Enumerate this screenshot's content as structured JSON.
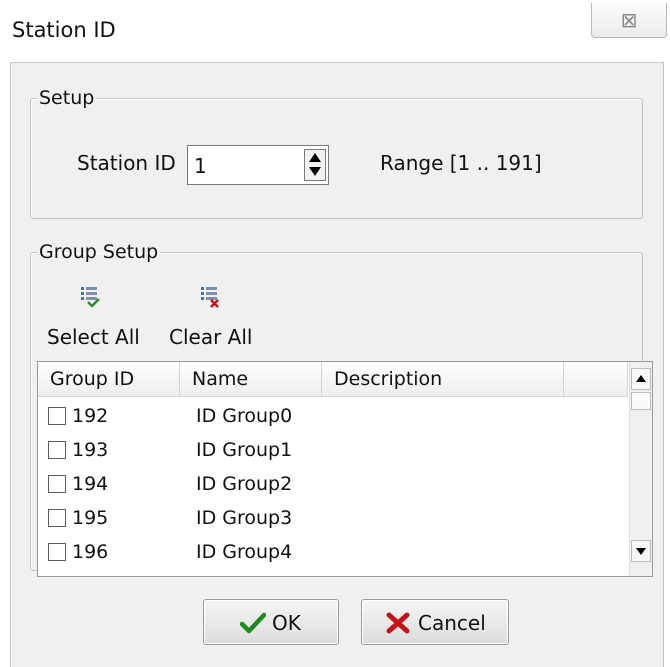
{
  "window": {
    "title": "Station ID",
    "close_glyph": "⊠"
  },
  "setup": {
    "legend": "Setup",
    "station_id_label": "Station ID",
    "station_id_value": "1",
    "range_text": "Range [1 .. 191]"
  },
  "group_setup": {
    "legend": "Group Setup",
    "toolbar": {
      "select_all": "Select All",
      "clear_all": "Clear All"
    },
    "columns": [
      "Group ID",
      "Name",
      "Description"
    ],
    "rows": [
      {
        "id": "192",
        "name": "ID Group0",
        "checked": false
      },
      {
        "id": "193",
        "name": "ID Group1",
        "checked": false
      },
      {
        "id": "194",
        "name": "ID Group2",
        "checked": false
      },
      {
        "id": "195",
        "name": "ID Group3",
        "checked": false
      },
      {
        "id": "196",
        "name": "ID Group4",
        "checked": false
      }
    ]
  },
  "buttons": {
    "ok": "OK",
    "cancel": "Cancel"
  },
  "colors": {
    "ok_check": "#1f8a1f",
    "cancel_x": "#c0141a",
    "dialog_bg": "#f0f0f0"
  },
  "icons": [
    "close-icon",
    "spin-up-icon",
    "spin-down-icon",
    "select-all-icon",
    "clear-all-icon",
    "scroll-up-icon",
    "scroll-down-icon",
    "check-icon",
    "x-icon"
  ]
}
